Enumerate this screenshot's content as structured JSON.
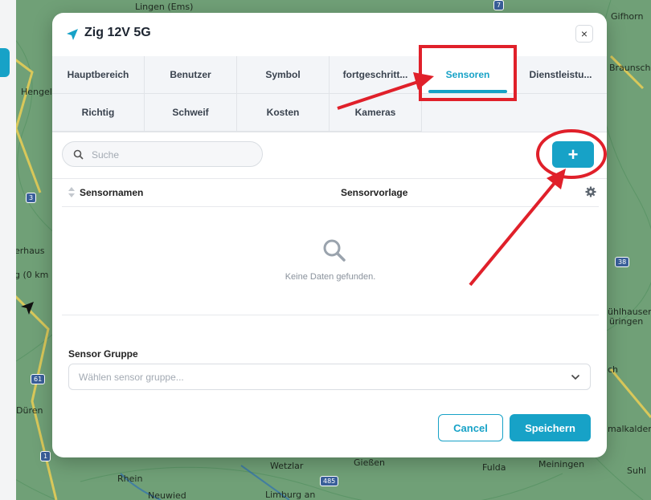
{
  "map": {
    "labels": [
      "Lingen (Ems)",
      "Gifhorn",
      "Hengelo",
      "Braunsch",
      "erhaus",
      "g (0 km",
      "38",
      "ühlhausen,",
      "üringen",
      "Düren",
      "Wetzlar",
      "Gießen",
      "Fulda",
      "Meiningen",
      "Neuwied",
      "Limburg an",
      "malkalden",
      "Suhl",
      "Rhein",
      "1",
      "3",
      "61",
      "485",
      "7",
      "ch"
    ]
  },
  "modal": {
    "title": "Zig 12V 5G",
    "close_label": "×",
    "tabs": [
      "Hauptbereich",
      "Benutzer",
      "Symbol",
      "fortgeschritt...",
      "Sensoren",
      "Dienstleistu...",
      "Richtig",
      "Schweif",
      "Kosten",
      "Kameras"
    ],
    "active_tab": "Sensoren",
    "search": {
      "placeholder": "Suche",
      "value": ""
    },
    "add_label": "+",
    "table": {
      "columns": [
        "Sensornamen",
        "Sensorvorlage"
      ],
      "empty_text": "Keine Daten gefunden."
    },
    "sensor_group": {
      "label": "Sensor Gruppe",
      "placeholder": "Wählen sensor gruppe..."
    },
    "cancel_label": "Cancel",
    "save_label": "Speichern"
  },
  "colors": {
    "accent": "#17a2c7",
    "annotation": "#e0202a"
  }
}
